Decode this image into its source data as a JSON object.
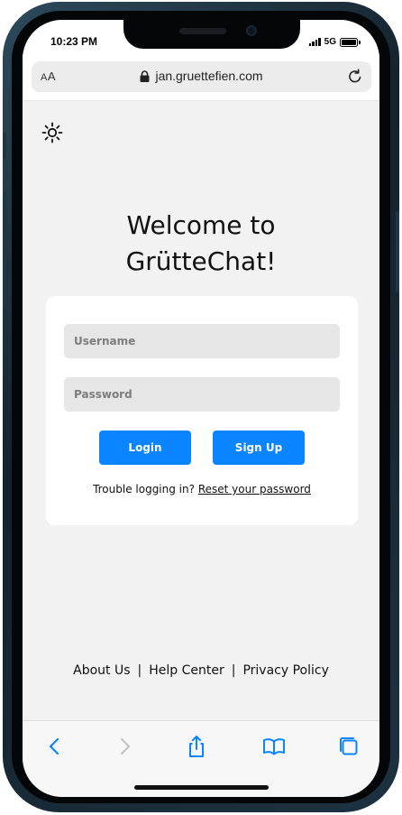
{
  "status_bar": {
    "time": "10:23 PM",
    "network": "5G",
    "signal_icon": "signal-bars-icon",
    "battery_icon": "battery-full-icon"
  },
  "browser": {
    "text_size_label_small": "A",
    "text_size_label_large": "A",
    "url": "jan.gruettefien.com",
    "lock_icon": "lock-icon",
    "reload_icon": "reload-icon"
  },
  "page": {
    "theme_toggle_icon": "sun-icon",
    "title_line1": "Welcome to",
    "title_line2": "GrütteChat!",
    "login_form": {
      "username_placeholder": "Username",
      "password_placeholder": "Password",
      "login_label": "Login",
      "signup_label": "Sign Up",
      "trouble_text": "Trouble logging in?",
      "reset_link": "Reset your password"
    },
    "footer": {
      "links": [
        "About Us",
        "Help Center",
        "Privacy Policy"
      ],
      "separator": "|"
    }
  },
  "toolbar": {
    "icons": [
      "back-icon",
      "forward-icon",
      "share-icon",
      "bookmarks-icon",
      "tabs-icon"
    ]
  },
  "colors": {
    "accent": "#0a84ff",
    "page_background": "#f2f2f2",
    "card_background": "#ffffff",
    "input_background": "#e6e6e6"
  }
}
